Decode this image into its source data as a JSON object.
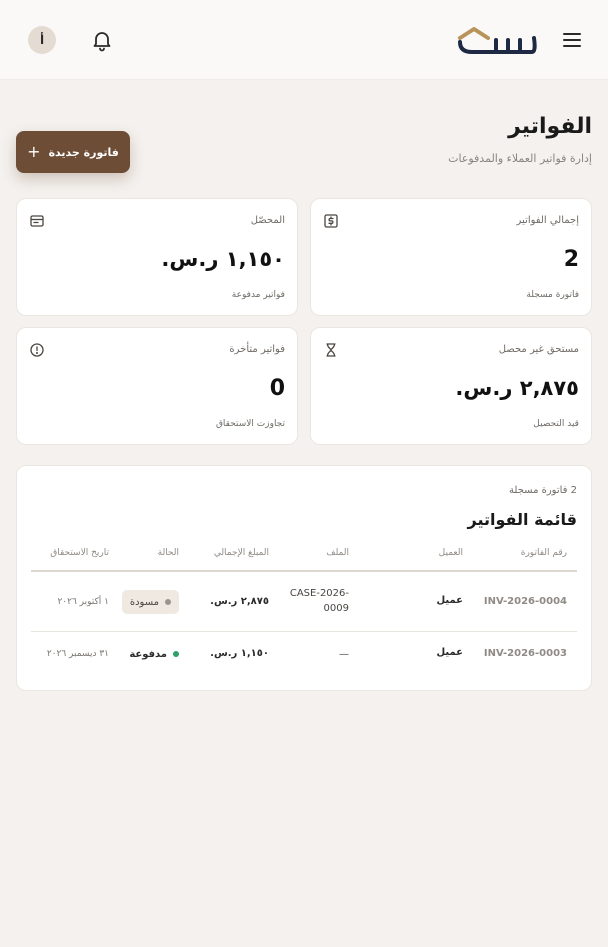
{
  "header": {
    "avatar_initial": "أ"
  },
  "page": {
    "title": "الفواتير",
    "subtitle": "إدارة فواتير العملاء والمدفوعات",
    "new_button_label": "فاتورة جديدة"
  },
  "stats": [
    {
      "label": "إجمالي الفواتير",
      "value": "2",
      "sub": "فاتورة مسجلة",
      "icon": "dollar-document-icon"
    },
    {
      "label": "المحصّل",
      "value": "١,١٥٠ ر.س.",
      "sub": "فواتير مدفوعة",
      "icon": "wallet-icon"
    },
    {
      "label": "مستحق غير محصل",
      "value": "٢,٨٧٥ ر.س.",
      "sub": "قيد التحصيل",
      "icon": "hourglass-icon"
    },
    {
      "label": "فواتير متأخرة",
      "value": "0",
      "sub": "تجاوزت الاستحقاق",
      "icon": "alert-circle-icon"
    }
  ],
  "invoices": {
    "count_text": "2 فاتورة مسجلة",
    "title": "قائمة الفواتير",
    "columns": [
      "رقم الفاتورة",
      "العميل",
      "الملف",
      "المبلغ الإجمالي",
      "الحالة",
      "تاريخ الاستحقاق"
    ],
    "rows": [
      {
        "number": "INV-2026-0004",
        "client": "عميل",
        "file": "CASE-2026-\n0009",
        "amount": "٢,٨٧٥ ر.س.",
        "status": "مسودة",
        "due": "١ أكتوبر ٢٠٢٦"
      },
      {
        "number": "INV-2026-0003",
        "client": "عميل",
        "file": "—",
        "amount": "١,١٥٠ ر.س.",
        "status": "مدفوعة",
        "due": "٣١ ديسمبر ٢٠٢٦"
      }
    ]
  },
  "colors": {
    "accent": "#6e4d37",
    "logo_gold": "#b8935a",
    "logo_navy": "#1e2a44",
    "status_paid": "#2e9e6a",
    "status_draft": "#9a9490"
  }
}
